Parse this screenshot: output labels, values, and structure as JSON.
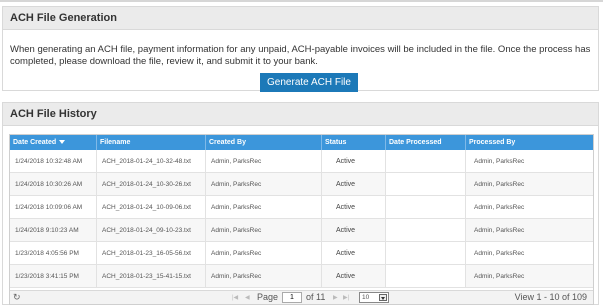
{
  "generation": {
    "title": "ACH File Generation",
    "description": "When generating an ACH file, payment information for any unpaid, ACH-payable invoices will be included in the file. Once the process has completed, please download the file, review it, and submit it to your bank.",
    "button_label": "Generate ACH File"
  },
  "history": {
    "title": "ACH File History",
    "columns": [
      "Date Created",
      "Filename",
      "Created By",
      "Status",
      "Date Processed",
      "Processed By"
    ],
    "rows": [
      {
        "date_created": "1/24/2018 10:32:48 AM",
        "filename": "ACH_2018-01-24_10-32-48.txt",
        "created_by": "Admin, ParksRec",
        "status": "Active",
        "date_processed": "",
        "processed_by": "Admin, ParksRec"
      },
      {
        "date_created": "1/24/2018 10:30:26 AM",
        "filename": "ACH_2018-01-24_10-30-26.txt",
        "created_by": "Admin, ParksRec",
        "status": "Active",
        "date_processed": "",
        "processed_by": "Admin, ParksRec"
      },
      {
        "date_created": "1/24/2018 10:09:06 AM",
        "filename": "ACH_2018-01-24_10-09-06.txt",
        "created_by": "Admin, ParksRec",
        "status": "Active",
        "date_processed": "",
        "processed_by": "Admin, ParksRec"
      },
      {
        "date_created": "1/24/2018 9:10:23 AM",
        "filename": "ACH_2018-01-24_09-10-23.txt",
        "created_by": "Admin, ParksRec",
        "status": "Active",
        "date_processed": "",
        "processed_by": "Admin, ParksRec"
      },
      {
        "date_created": "1/23/2018 4:05:56 PM",
        "filename": "ACH_2018-01-23_16-05-56.txt",
        "created_by": "Admin, ParksRec",
        "status": "Active",
        "date_processed": "",
        "processed_by": "Admin, ParksRec"
      },
      {
        "date_created": "1/23/2018 3:41:15 PM",
        "filename": "ACH_2018-01-23_15-41-15.txt",
        "created_by": "Admin, ParksRec",
        "status": "Active",
        "date_processed": "",
        "processed_by": "Admin, ParksRec"
      }
    ],
    "pager": {
      "page_label": "Page",
      "current_page": "1",
      "of_label": "of 11",
      "page_size": "10",
      "view_label": "View 1 - 10 of 109"
    }
  }
}
